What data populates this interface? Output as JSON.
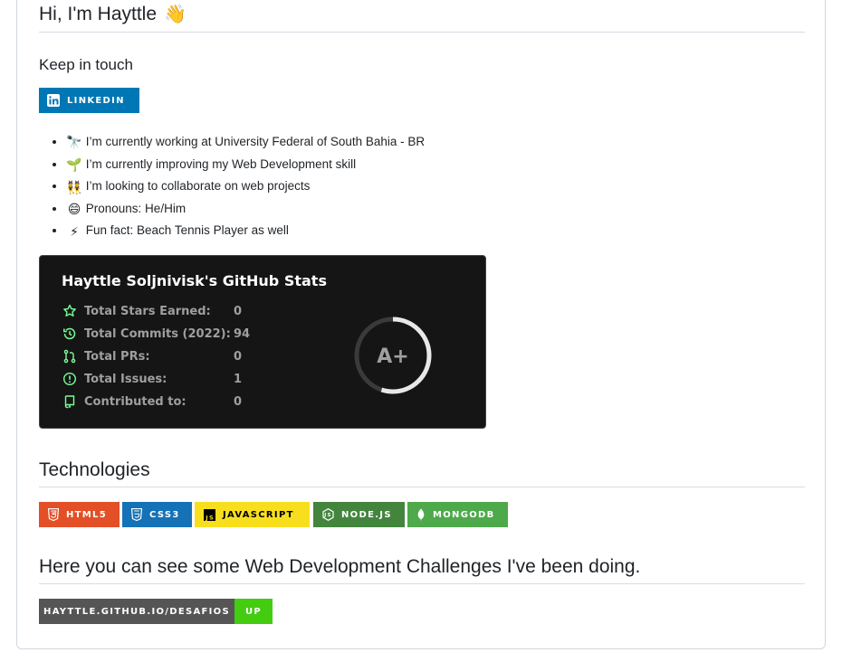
{
  "header": {
    "title": "Hi, I'm Hayttle",
    "emoji": "👋"
  },
  "contact": {
    "heading": "Keep in touch",
    "linkedin": {
      "label": "LINKEDIN",
      "color": "#0077b5",
      "icon": "linkedin-icon"
    }
  },
  "facts": [
    {
      "emoji": "🔭",
      "icon": "telescope-icon",
      "text": "I’m currently working at University Federal of South Bahia - BR"
    },
    {
      "emoji": "🌱",
      "icon": "seedling-icon",
      "text": "I’m currently improving my Web Development skill"
    },
    {
      "emoji": "👯",
      "icon": "people-icon",
      "text": "I’m looking to collaborate on web projects"
    },
    {
      "emoji": "😄",
      "icon": "smile-icon",
      "text": "Pronouns: He/Him"
    },
    {
      "emoji": "⚡",
      "icon": "lightning-icon",
      "text": "Fun fact: Beach Tennis Player as well"
    }
  ],
  "stats": {
    "title": "Hayttle Soljnivisk's GitHub Stats",
    "rows": [
      {
        "icon": "star-icon",
        "label": "Total Stars Earned:",
        "value": "0"
      },
      {
        "icon": "history-icon",
        "label": "Total Commits (2022):",
        "value": "94"
      },
      {
        "icon": "pull-request-icon",
        "label": "Total PRs:",
        "value": "0"
      },
      {
        "icon": "issue-icon",
        "label": "Total Issues:",
        "value": "1"
      },
      {
        "icon": "repo-icon",
        "label": "Contributed to:",
        "value": "0"
      }
    ],
    "rank": "A+",
    "rank_progress": 0.55,
    "icon_color": "#79ff97"
  },
  "technologies": {
    "heading": "Technologies",
    "badges": [
      {
        "label": "HTML5",
        "icon": "html5-icon",
        "bg": "#e34f26",
        "fg": "#ffffff"
      },
      {
        "label": "CSS3",
        "icon": "css3-icon",
        "bg": "#1572b6",
        "fg": "#ffffff"
      },
      {
        "label": "JAVASCRIPT",
        "icon": "javascript-icon",
        "bg": "#f7df1e",
        "fg": "#000000"
      },
      {
        "label": "NODE.JS",
        "icon": "nodejs-icon",
        "bg": "#43853d",
        "fg": "#ffffff"
      },
      {
        "label": "MONGODB",
        "icon": "mongodb-icon",
        "bg": "#4ea94b",
        "fg": "#ffffff"
      }
    ]
  },
  "challenges": {
    "heading": "Here you can see some Web Development Challenges I've been doing.",
    "badge_left": "HAYTTLE.GITHUB.IO/DESAFIOS",
    "badge_right": "UP",
    "left_color": "#555555",
    "right_color": "#4c1"
  }
}
